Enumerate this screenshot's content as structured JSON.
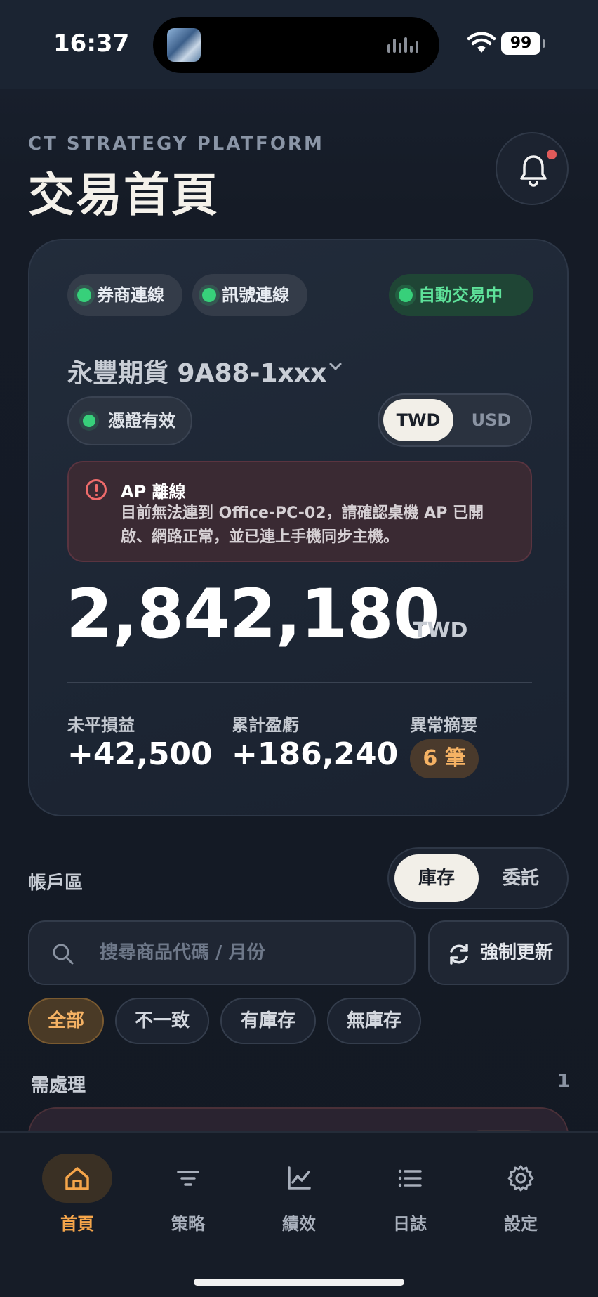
{
  "status_bar": {
    "time": "16:37",
    "battery": "99"
  },
  "header": {
    "brand": "CT STRATEGY PLATFORM",
    "title": "交易首頁",
    "notification_icon": "bell-icon"
  },
  "summary_card": {
    "status_pills": [
      {
        "label": "券商連線"
      },
      {
        "label": "訊號連線"
      },
      {
        "label": "自動交易中"
      }
    ],
    "account_name": "永豐期貨 9A88-1xxx",
    "certificate_label": "憑證有效",
    "currency_options": [
      "TWD",
      "USD"
    ],
    "currency_selected": "TWD",
    "alert": {
      "title": "AP 離線",
      "message": "目前無法連到 Office-PC-02，請確認桌機 AP 已開啟、網路正常，並已連上手機同步主機。"
    },
    "balance": "2,842,180",
    "balance_currency": "TWD",
    "stats": [
      {
        "label": "未平損益",
        "value": "+42,500"
      },
      {
        "label": "累計盈虧",
        "value": "+186,240"
      }
    ],
    "anomaly_label": "異常摘要",
    "anomaly_value": "6 筆"
  },
  "account_section": {
    "label": "帳戶區",
    "segments": [
      "庫存",
      "委託"
    ],
    "segment_selected": "庫存",
    "search_placeholder": "搜尋商品代碼 / 月份",
    "refresh_label": "強制更新",
    "filters": [
      "全部",
      "不一致",
      "有庫存",
      "無庫存"
    ],
    "filter_selected": "全部",
    "pending_label": "需處理",
    "pending_count": "1"
  },
  "tab_bar": {
    "tabs": [
      {
        "label": "首頁",
        "icon": "home-icon"
      },
      {
        "label": "策略",
        "icon": "filter-icon"
      },
      {
        "label": "績效",
        "icon": "chart-line-icon"
      },
      {
        "label": "日誌",
        "icon": "list-icon"
      },
      {
        "label": "設定",
        "icon": "gear-icon"
      }
    ],
    "active": "首頁"
  },
  "colors": {
    "accent": "#f5a54a",
    "success": "#37d07a",
    "danger": "#ef6b6b",
    "background": "#141a24"
  }
}
